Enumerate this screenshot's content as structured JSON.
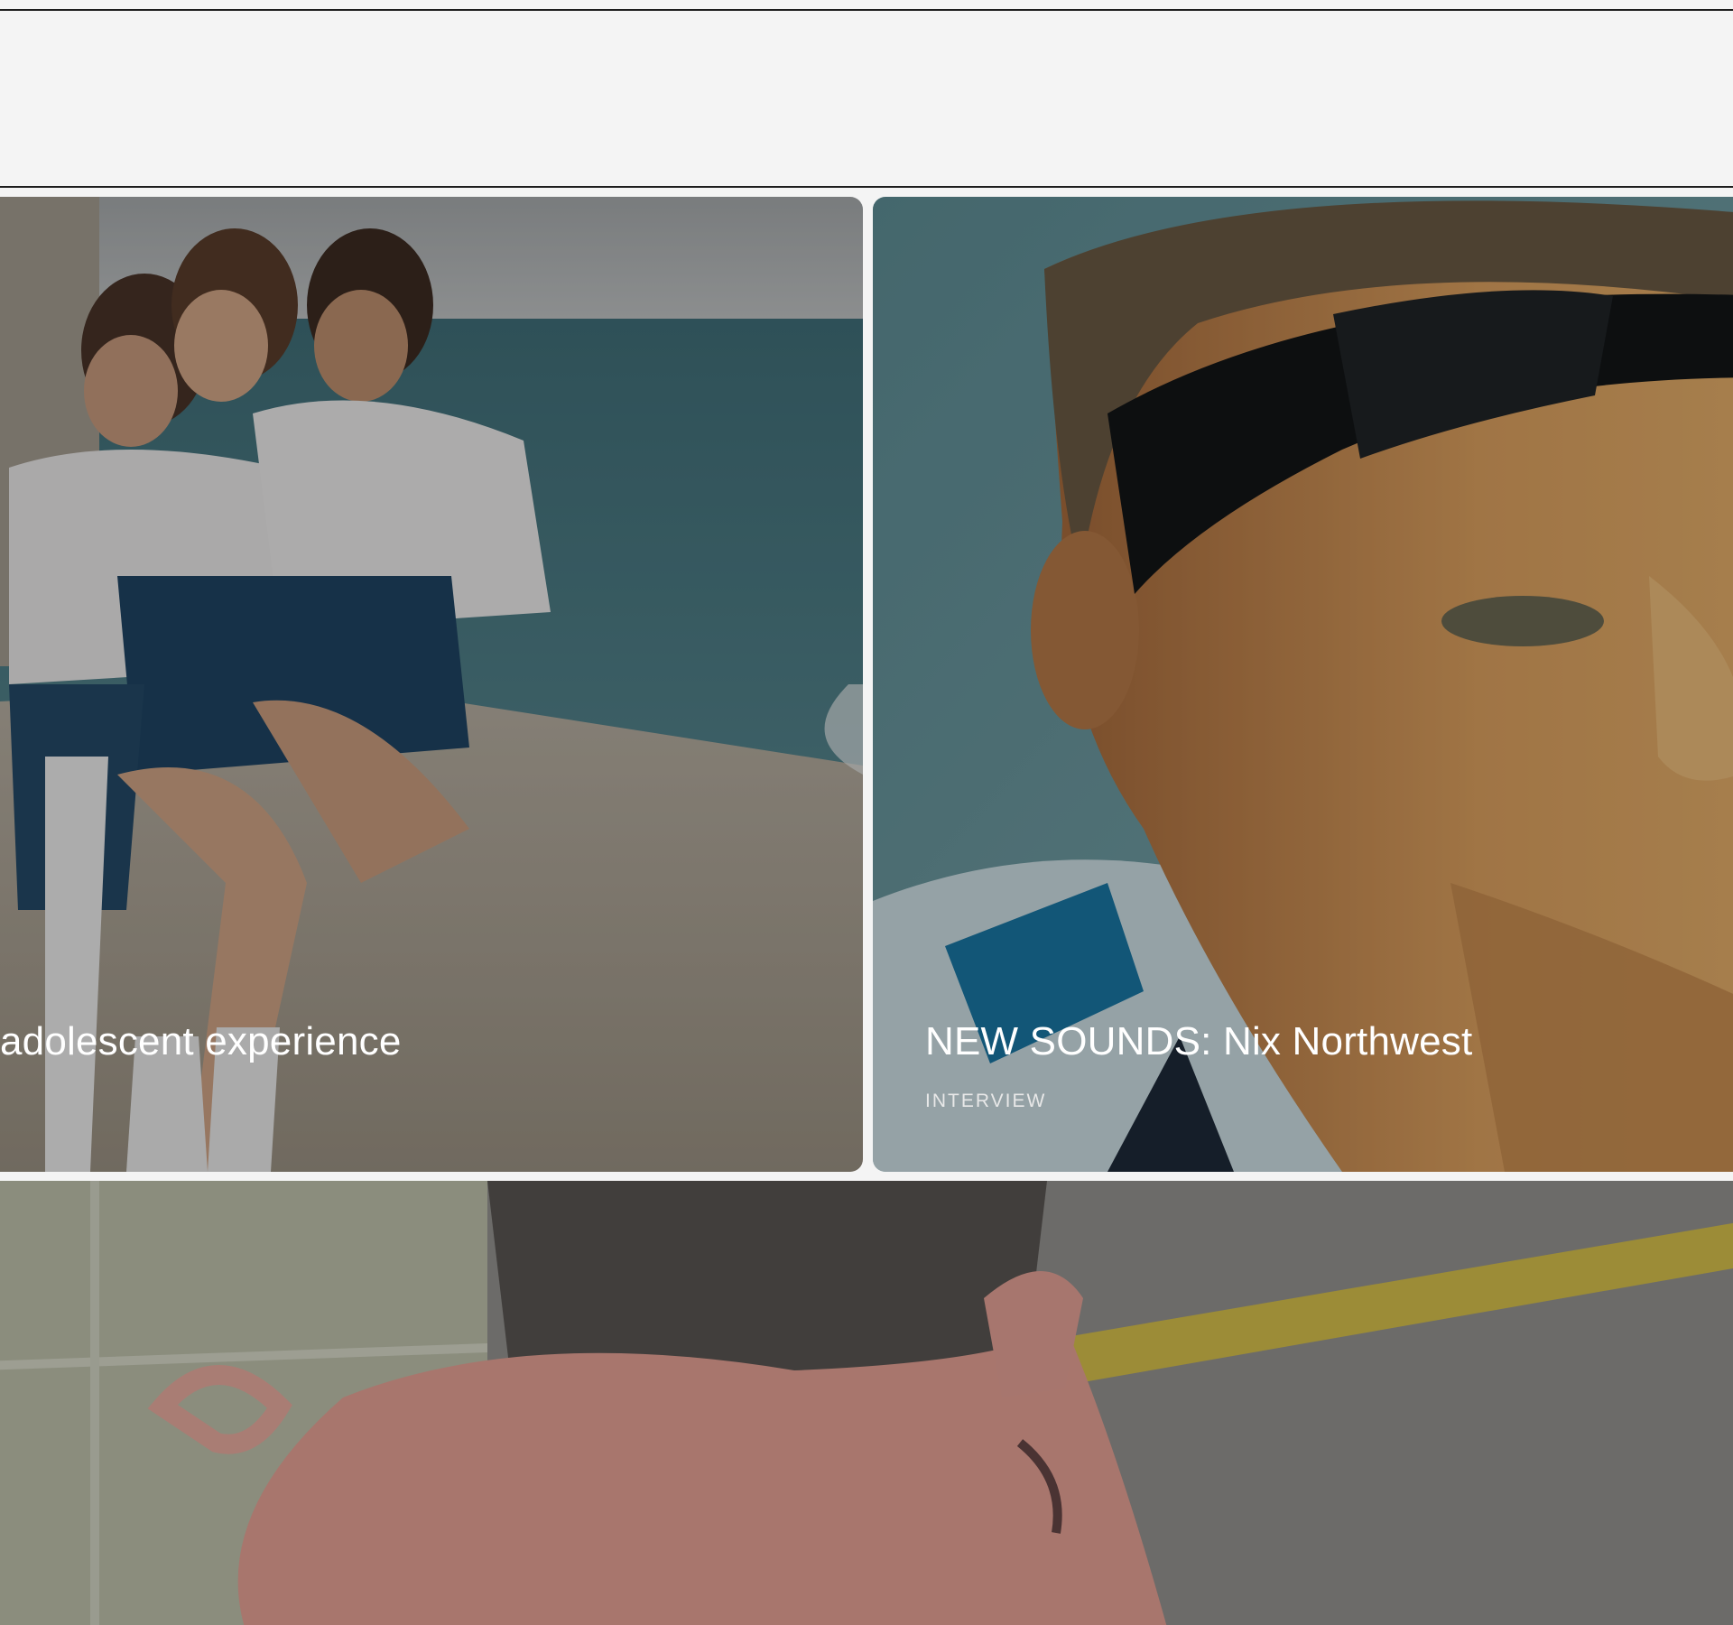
{
  "cards": [
    {
      "title": "adolescent experience",
      "tag": ""
    },
    {
      "title": "NEW SOUNDS: Nix Northwest",
      "tag": "INTERVIEW"
    },
    {
      "title": "",
      "tag": ""
    }
  ],
  "colors": {
    "background": "#f4f4f4",
    "rule": "#1d1d1d",
    "text_on_image": "#ffffff"
  }
}
